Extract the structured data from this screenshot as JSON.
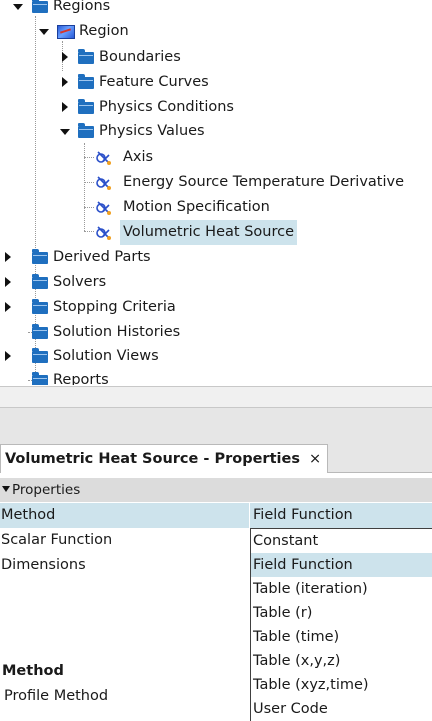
{
  "tree": {
    "regions": "Regions",
    "region": "Region",
    "boundaries": "Boundaries",
    "feature_curves": "Feature Curves",
    "physics_conditions": "Physics Conditions",
    "physics_values": "Physics Values",
    "axis": "Axis",
    "energy_source": "Energy Source Temperature Derivative",
    "motion_spec": "Motion Specification",
    "volumetric_heat": "Volumetric Heat Source",
    "derived_parts": "Derived Parts",
    "solvers": "Solvers",
    "stopping_criteria": "Stopping Criteria",
    "solution_histories": "Solution Histories",
    "solution_views": "Solution Views",
    "reports": "Reports"
  },
  "properties": {
    "tab_title": "Volumetric Heat Source - Properties",
    "tab_close": "×",
    "section": "Properties",
    "rows": [
      {
        "name": "Method",
        "value": "Field Function"
      },
      {
        "name": "Scalar Function",
        "value": ""
      },
      {
        "name": "Dimensions",
        "value": ""
      }
    ],
    "dropdown_options": [
      "Constant",
      "Field Function",
      "Table (iteration)",
      "Table (r)",
      "Table (time)",
      "Table (x,y,z)",
      "Table (xyz,time)",
      "User Code"
    ],
    "dropdown_selected": "Field Function",
    "help_title": "Method",
    "help_text": "Profile Method"
  },
  "colors": {
    "selection": "#cde3ec",
    "folder": "#1f6fbf",
    "panel_bg": "#e6e6e6"
  }
}
